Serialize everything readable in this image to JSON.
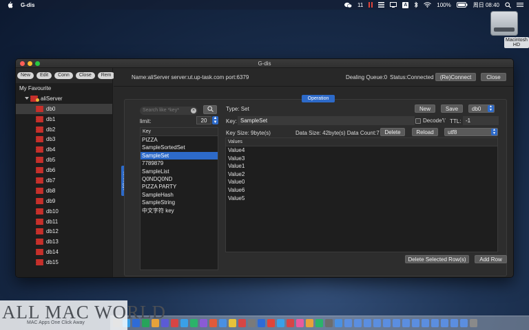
{
  "menubar": {
    "app_name": "G-dis",
    "notification_count": "11",
    "battery": "100%",
    "clock": "周日 08:40",
    "input_badge": "A"
  },
  "desktop": {
    "drive_label": "Macintosh HD"
  },
  "window": {
    "title": "G-dis",
    "toolbar": [
      "New",
      "Edit",
      "Conn",
      "Close",
      "Rem"
    ],
    "tree": {
      "favourite": "My Favourite",
      "server": "aliServer",
      "databases": [
        "db0",
        "db1",
        "db2",
        "db3",
        "db4",
        "db5",
        "db6",
        "db7",
        "db8",
        "db9",
        "db10",
        "db11",
        "db12",
        "db13",
        "db14",
        "db15"
      ]
    },
    "info": {
      "connection": "Name:aliServer server:ut.up-task.com port:6379",
      "queue": "Dealing Queue:0",
      "status": "Status:Connected",
      "reconnect_label": "(Re)Connect",
      "close_label": "Close"
    },
    "side_tab": "aliServer",
    "operation_tab": "Operation",
    "search": {
      "placeholder": "Search like *key*",
      "search_icon": "magnifier-icon"
    },
    "limit": {
      "label": "limit:",
      "value": "20"
    },
    "key_list": {
      "header": "Key",
      "items": [
        "PIZZA",
        "SampleSortedSet",
        "SampleSet",
        "7789879",
        "SampleList",
        "Q0NDQ0ND",
        "PIZZA PARTY",
        "SampleHash",
        "SampleString",
        "中文字符 key"
      ],
      "selected": "SampleSet"
    },
    "detail": {
      "type": "Type: Set",
      "new_label": "New",
      "save_label": "Save",
      "db_select": "db0",
      "key_label": "Key:",
      "key_value": "SampleSet",
      "decode_label": "Decode'\\'",
      "ttl_label": "TTL:",
      "ttl_value": "-1",
      "key_size": "Key Size: 9byte(s)",
      "data_size": "Data Size: 42byte(s) Data Count:7",
      "delete_label": "Delete",
      "reload_label": "Reload",
      "encoding": "utf8",
      "values_header": "Values",
      "values": [
        "Value4",
        "Value3",
        "Value1",
        "Value2",
        "Value0",
        "Value6",
        "Value5"
      ],
      "delete_selected_label": "Delete Selected Row(s)",
      "add_row_label": "Add Row"
    }
  },
  "watermark": {
    "big": "ALL MAC WORLD",
    "small": "MAC Apps One Click Away"
  },
  "colors": {
    "accent": "#2d6ac9",
    "redis_red": "#c6302b",
    "window_bg": "#282828"
  }
}
